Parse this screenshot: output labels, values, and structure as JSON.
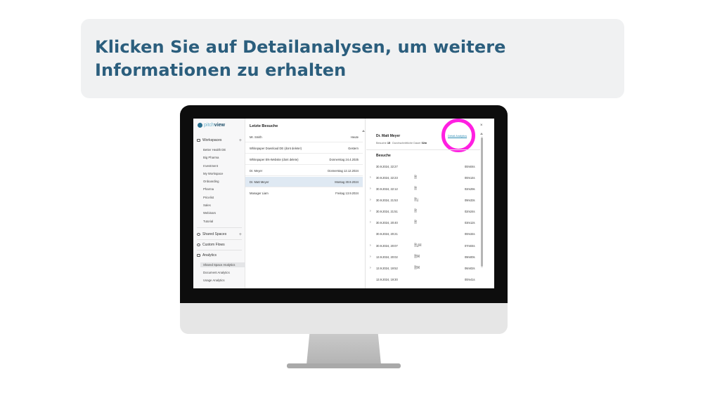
{
  "banner": {
    "text": "Klicken Sie auf Detailanalysen, um weitere Informationen zu erhalten"
  },
  "app": {
    "logo_a": "pitch",
    "logo_b": "view",
    "sidebar": {
      "workspaces": "Workspaces",
      "workspace_items": [
        "Better Health DE",
        "Big Pharma",
        "Investment",
        "My Workspace",
        "Onboarding",
        "Pharma",
        "Pricelist",
        "Sales",
        "Webinars",
        "Tutorial"
      ],
      "shared_spaces": "Shared Spaces",
      "custom_flows": "Custom Flows",
      "analytics": "Analytics",
      "analytics_items": [
        "Shared Space Analytics",
        "Document Analytics",
        "Usage Analytics"
      ]
    },
    "recent": {
      "title": "Letzte Besuche",
      "rows": [
        {
          "name": "Mr. Smith",
          "date": "Heute"
        },
        {
          "name": "Whitepaper Download DE (dont delete!)",
          "date": "Gestern"
        },
        {
          "name": "Whitepaper EN-Website (dont delete)",
          "date": "Donnerstag 24.4.2025"
        },
        {
          "name": "Dr. Meyer",
          "date": "Donnerstag 12.12.2024"
        },
        {
          "name": "Dr. Matt Meyer",
          "date": "Montag 30.9.2024"
        },
        {
          "name": "Manager Liam",
          "date": "Freitag 13.9.2024"
        }
      ]
    },
    "detail": {
      "name": "Dr. Matt Meyer",
      "link": "Detail Analytics",
      "visits_label": "Besuche",
      "visits_count": "15",
      "avg_label": "Durchschnittliche Dauer",
      "avg_value": "02m",
      "section": "Besuche",
      "visits": [
        {
          "date": "30.9.2024, 22:27",
          "duration": "00m04s",
          "icons": ""
        },
        {
          "date": "30.9.2024, 22:23",
          "duration": "00m14s",
          "icons": "🗎"
        },
        {
          "date": "30.9.2024, 22:12",
          "duration": "02m29s",
          "icons": "🗎"
        },
        {
          "date": "30.9.2024, 21:53",
          "duration": "09m33s",
          "icons": "🗎⤓"
        },
        {
          "date": "30.9.2024, 21:51",
          "duration": "02m24s",
          "icons": "🗎"
        },
        {
          "date": "30.9.2024, 20:40",
          "duration": "03m12s",
          "icons": "🗎"
        },
        {
          "date": "30.9.2024, 20:21",
          "duration": "00m34s",
          "icons": ""
        },
        {
          "date": "30.9.2024, 20:07",
          "duration": "07m04s",
          "icons": "🗎⤓▣"
        },
        {
          "date": "13.9.2024, 20:02",
          "duration": "09m00s",
          "icons": "🗎▣"
        },
        {
          "date": "13.9.2024, 19:52",
          "duration": "06m02s",
          "icons": "🗎▣"
        },
        {
          "date": "13.9.2024, 19:30",
          "duration": "00m41s",
          "icons": ""
        }
      ]
    }
  },
  "colors": {
    "title": "#2b5e7d",
    "highlight": "#ff1fe1",
    "link": "#2b8bb3",
    "selected": "#dfe9f3"
  }
}
